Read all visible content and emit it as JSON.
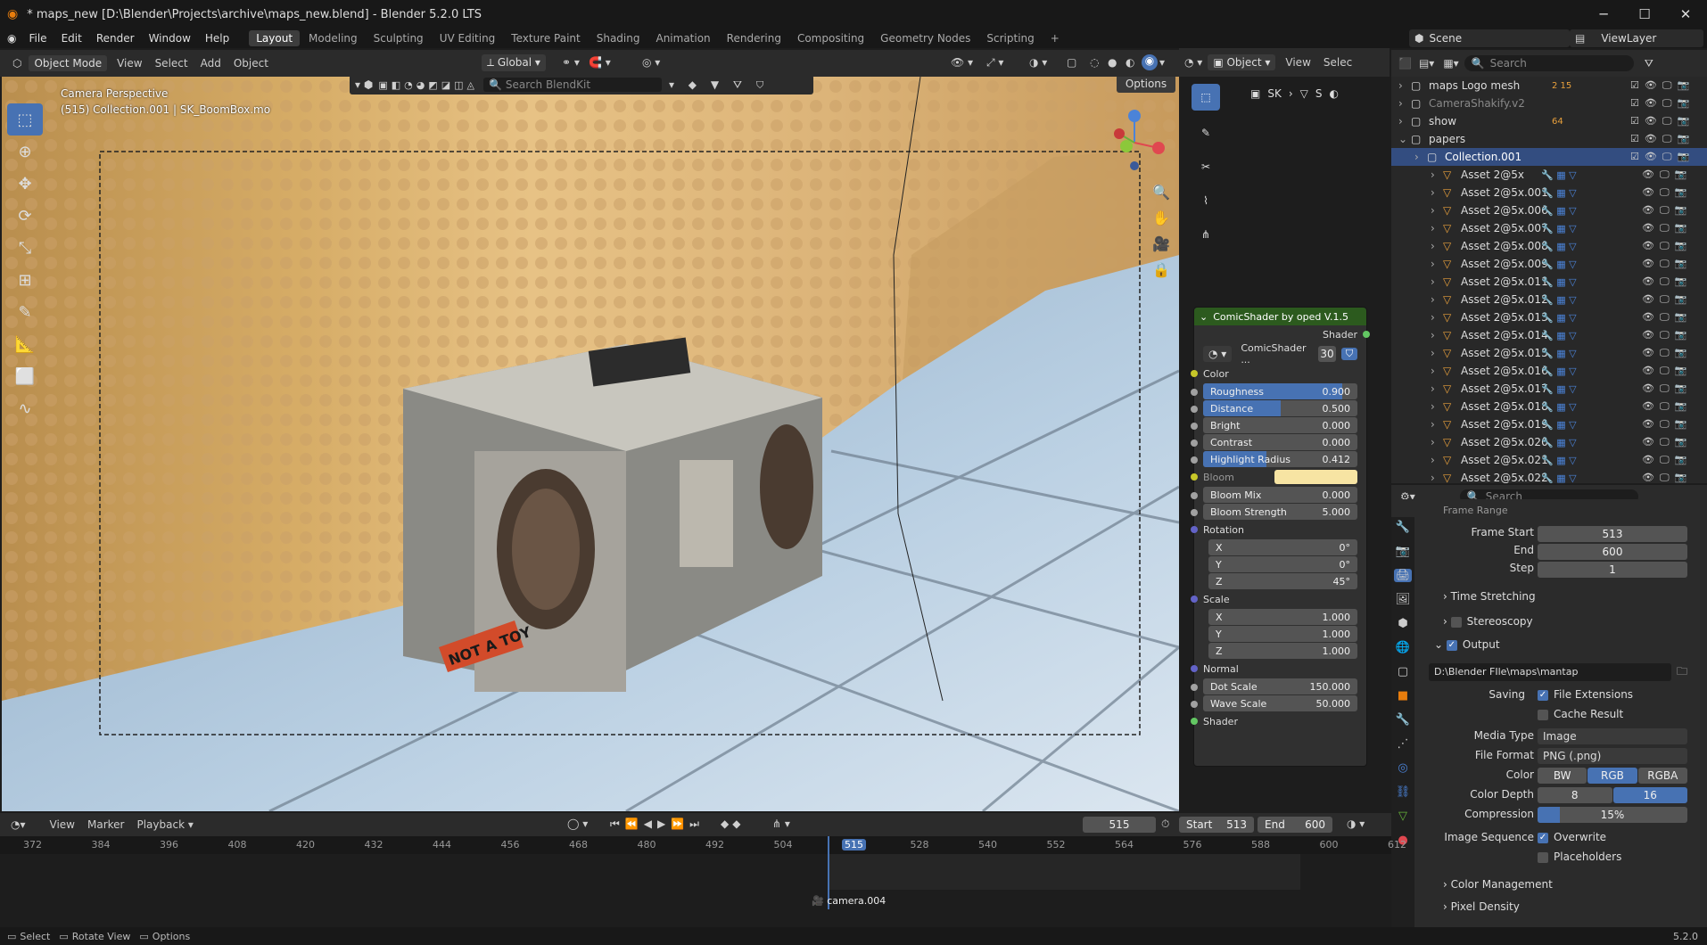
{
  "window": {
    "title": "* maps_new [D:\\Blender\\Projects\\archive\\maps_new.blend] - Blender 5.2.0 LTS",
    "minimize": "─",
    "maximize": "☐",
    "close": "✕"
  },
  "menu": [
    "File",
    "Edit",
    "Render",
    "Window",
    "Help"
  ],
  "workspaces": [
    "Layout",
    "Modeling",
    "Sculpting",
    "UV Editing",
    "Texture Paint",
    "Shading",
    "Animation",
    "Rendering",
    "Compositing",
    "Geometry Nodes",
    "Scripting"
  ],
  "active_workspace": "Layout",
  "scene": {
    "label": "Scene",
    "viewlayer": "ViewLayer"
  },
  "viewport_header": {
    "mode": "Object Mode",
    "items": [
      "View",
      "Select",
      "Add",
      "Object"
    ],
    "orientation": "Global",
    "options": "Options"
  },
  "blendkit": {
    "search_placeholder": "Search BlendKit"
  },
  "viewport": {
    "camera": "Camera Perspective",
    "info": "(515) Collection.001 | SK_BoomBox.mo",
    "sticker": "NOT A TOY"
  },
  "node_header": {
    "object": "Object",
    "view": "View",
    "select": "Selec",
    "breadcrumb": [
      "SK",
      "S"
    ]
  },
  "node": {
    "title": "ComicShader by oped  V.1.5",
    "output": "Shader",
    "datablock": "ComicShader ...",
    "users": "30",
    "color_label": "Color",
    "fields1": [
      {
        "label": "Roughness",
        "value": "0.900",
        "fill": 0.9
      },
      {
        "label": "Distance",
        "value": "0.500",
        "fill": 0.5
      },
      {
        "label": "Bright",
        "value": "0.000",
        "fill": 0
      },
      {
        "label": "Contrast",
        "value": "0.000",
        "fill": 0
      },
      {
        "label": "Highlight Radius",
        "value": "0.412",
        "fill": 0.412
      }
    ],
    "bloom_label": "Bloom",
    "bloom_color": "#f7e4a3",
    "fields2": [
      {
        "label": "Bloom Mix",
        "value": "0.000"
      },
      {
        "label": "Bloom Strength",
        "value": "5.000"
      }
    ],
    "rotation_label": "Rotation",
    "rotation": [
      {
        "label": "X",
        "value": "0°"
      },
      {
        "label": "Y",
        "value": "0°"
      },
      {
        "label": "Z",
        "value": "45°"
      }
    ],
    "scale_label": "Scale",
    "scale": [
      {
        "label": "X",
        "value": "1.000"
      },
      {
        "label": "Y",
        "value": "1.000"
      },
      {
        "label": "Z",
        "value": "1.000"
      }
    ],
    "normal_label": "Normal",
    "fields3": [
      {
        "label": "Dot Scale",
        "value": "150.000"
      },
      {
        "label": "Wave Scale",
        "value": "50.000"
      }
    ],
    "input_shader": "Shader"
  },
  "outliner": {
    "search_placeholder": "Search",
    "rows": [
      {
        "name": "maps Logo mesh",
        "indent": 0,
        "kind": "collection",
        "badge": "2  15"
      },
      {
        "name": "CameraShakify.v2",
        "indent": 0,
        "kind": "collection-dim",
        "badge": ""
      },
      {
        "name": "show",
        "indent": 0,
        "kind": "collection",
        "badge": "64"
      },
      {
        "name": "papers",
        "indent": 0,
        "kind": "collection",
        "badge": ""
      },
      {
        "name": "Collection.001",
        "indent": 1,
        "kind": "collection-active",
        "badge": ""
      },
      {
        "name": "Asset 2@5x",
        "indent": 2,
        "kind": "mesh",
        "badge": ""
      },
      {
        "name": "Asset 2@5x.001",
        "indent": 2,
        "kind": "mesh",
        "badge": ""
      },
      {
        "name": "Asset 2@5x.006",
        "indent": 2,
        "kind": "mesh",
        "badge": ""
      },
      {
        "name": "Asset 2@5x.007",
        "indent": 2,
        "kind": "mesh",
        "badge": ""
      },
      {
        "name": "Asset 2@5x.008",
        "indent": 2,
        "kind": "mesh",
        "badge": ""
      },
      {
        "name": "Asset 2@5x.009",
        "indent": 2,
        "kind": "mesh",
        "badge": ""
      },
      {
        "name": "Asset 2@5x.011",
        "indent": 2,
        "kind": "mesh",
        "badge": ""
      },
      {
        "name": "Asset 2@5x.012",
        "indent": 2,
        "kind": "mesh",
        "badge": ""
      },
      {
        "name": "Asset 2@5x.013",
        "indent": 2,
        "kind": "mesh",
        "badge": ""
      },
      {
        "name": "Asset 2@5x.014",
        "indent": 2,
        "kind": "mesh",
        "badge": ""
      },
      {
        "name": "Asset 2@5x.015",
        "indent": 2,
        "kind": "mesh",
        "badge": ""
      },
      {
        "name": "Asset 2@5x.016",
        "indent": 2,
        "kind": "mesh",
        "badge": ""
      },
      {
        "name": "Asset 2@5x.017",
        "indent": 2,
        "kind": "mesh",
        "badge": ""
      },
      {
        "name": "Asset 2@5x.018",
        "indent": 2,
        "kind": "mesh",
        "badge": ""
      },
      {
        "name": "Asset 2@5x.019",
        "indent": 2,
        "kind": "mesh",
        "badge": ""
      },
      {
        "name": "Asset 2@5x.020",
        "indent": 2,
        "kind": "mesh",
        "badge": ""
      },
      {
        "name": "Asset 2@5x.021",
        "indent": 2,
        "kind": "mesh",
        "badge": ""
      },
      {
        "name": "Asset 2@5x.022",
        "indent": 2,
        "kind": "mesh",
        "badge": ""
      }
    ]
  },
  "properties": {
    "search_placeholder": "Search",
    "frame_range_label": "Frame Range",
    "frame_start_label": "Frame Start",
    "frame_start": "513",
    "end_label": "End",
    "end": "600",
    "step_label": "Step",
    "step": "1",
    "time_stretching": "Time Stretching",
    "stereoscopy": "Stereoscopy",
    "output": "Output",
    "path": "D:\\Blender FIle\\maps\\mantap",
    "saving_label": "Saving",
    "file_extensions": "File Extensions",
    "cache_result": "Cache Result",
    "media_type_label": "Media Type",
    "media_type": "Image",
    "file_format_label": "File Format",
    "file_format": "PNG (.png)",
    "color_label": "Color",
    "color_modes": [
      "BW",
      "RGB",
      "RGBA"
    ],
    "color_active": "RGB",
    "color_depth_label": "Color Depth",
    "color_depths": [
      "8",
      "16"
    ],
    "depth_active": "16",
    "compression_label": "Compression",
    "compression": "15%",
    "compression_fill": 0.15,
    "image_sequence_label": "Image Sequence",
    "overwrite": "Overwrite",
    "placeholders": "Placeholders",
    "color_management": "Color Management",
    "pixel_density": "Pixel Density"
  },
  "timeline": {
    "menus": [
      "View",
      "Marker",
      "Playback"
    ],
    "current_frame": "515",
    "start_label": "Start",
    "start": "513",
    "end_label": "End",
    "end": "600",
    "ticks": [
      "372",
      "384",
      "396",
      "408",
      "420",
      "432",
      "444",
      "456",
      "468",
      "480",
      "492",
      "504",
      "515",
      "528",
      "540",
      "552",
      "564",
      "576",
      "588",
      "600",
      "612"
    ],
    "marker": "camera.004"
  },
  "status": {
    "select": "Select",
    "rotate": "Rotate View",
    "options": "Options",
    "version": "5.2.0"
  }
}
